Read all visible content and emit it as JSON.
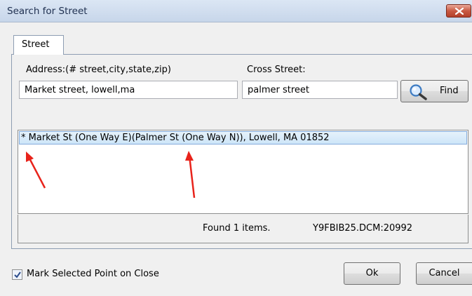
{
  "window": {
    "title": "Search for Street",
    "close_icon": "close-icon",
    "close_color": "#c95a43"
  },
  "tabs": [
    {
      "label": "Street",
      "active": true
    }
  ],
  "form": {
    "address_label": "Address:(# street,city,state,zip)",
    "address_value": "Market street, lowell,ma",
    "cross_label": "Cross Street:",
    "cross_value": "palmer street",
    "find_label": "Find",
    "find_icon": "magnifier-icon"
  },
  "results": [
    {
      "text": "* Market St (One Way E)(Palmer St (One Way N)), Lowell, MA 01852",
      "selected": true
    }
  ],
  "status": {
    "found": "Found 1 items.",
    "file": "Y9FBIB25.DCM:20992"
  },
  "footer": {
    "checkbox_label": "Mark Selected Point on Close",
    "checkbox_checked": true,
    "ok_label": "Ok",
    "cancel_label": "Cancel"
  },
  "annotations": {
    "arrow_icon": "red-arrow-icon",
    "arrow_color": "#e8231b"
  },
  "colors": {
    "selection": "#cde5f8",
    "titlebar": "#c7d6ea"
  }
}
